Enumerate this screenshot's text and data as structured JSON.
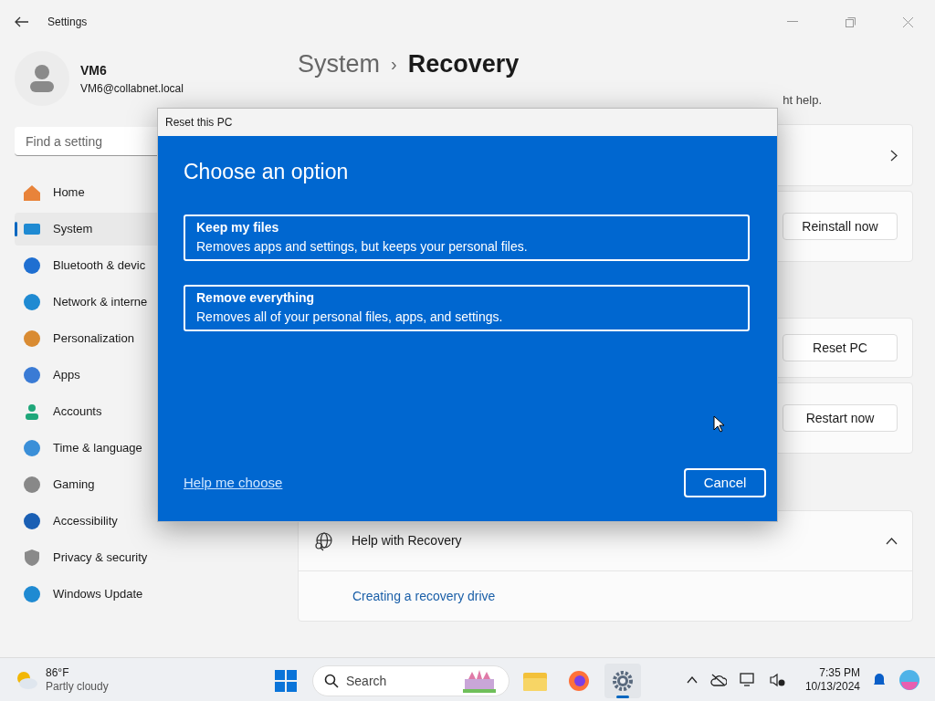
{
  "window": {
    "title": "Settings"
  },
  "user": {
    "name": "VM6",
    "email": "VM6@collabnet.local"
  },
  "search": {
    "placeholder": "Find a setting"
  },
  "nav": [
    {
      "label": "Home",
      "selected": false
    },
    {
      "label": "System",
      "selected": true
    },
    {
      "label": "Bluetooth & devic",
      "selected": false
    },
    {
      "label": "Network & interne",
      "selected": false
    },
    {
      "label": "Personalization",
      "selected": false
    },
    {
      "label": "Apps",
      "selected": false
    },
    {
      "label": "Accounts",
      "selected": false
    },
    {
      "label": "Time & language",
      "selected": false
    },
    {
      "label": "Gaming",
      "selected": false
    },
    {
      "label": "Accessibility",
      "selected": false
    },
    {
      "label": "Privacy & security",
      "selected": false
    },
    {
      "label": "Windows Update",
      "selected": false
    }
  ],
  "breadcrumb": {
    "parent": "System",
    "separator": "›",
    "current": "Recovery"
  },
  "intro_tail": "ht help.",
  "cards": [
    {
      "kind": "chevron"
    },
    {
      "kind": "button",
      "button": "Reinstall now"
    },
    {
      "kind": "button",
      "button": "Reset PC"
    },
    {
      "kind": "button",
      "button": "Restart now"
    }
  ],
  "related": {
    "title": "Help with Recovery",
    "expanded": true,
    "link": "Creating a recovery drive"
  },
  "dialog": {
    "title": "Reset this PC",
    "heading": "Choose an option",
    "options": [
      {
        "title": "Keep my files",
        "description": "Removes apps and settings, but keeps your personal files."
      },
      {
        "title": "Remove everything",
        "description": "Removes all of your personal files, apps, and settings."
      }
    ],
    "help_link": "Help me choose",
    "cancel": "Cancel"
  },
  "taskbar": {
    "temperature": "86°F",
    "weather": "Partly cloudy",
    "search": "Search",
    "apps": [
      {
        "kind": "explorer",
        "selected": false
      },
      {
        "kind": "firefox",
        "selected": false
      },
      {
        "kind": "settings",
        "selected": true
      }
    ],
    "time": "7:35 PM",
    "date": "10/13/2024"
  }
}
